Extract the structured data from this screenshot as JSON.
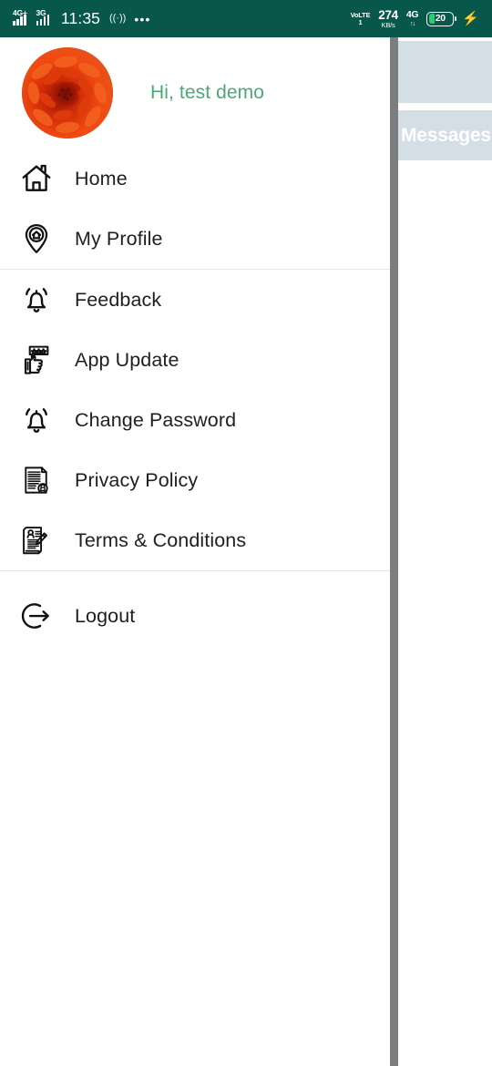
{
  "status_bar": {
    "background_color": "#07584A",
    "time": "11:35",
    "sim1_network": "4G+",
    "sim2_network": "3G",
    "hotspot_icon": "hotspot-icon",
    "overflow_icon": "more-dots-icon",
    "volte_label": "VoLTE1",
    "net_speed_value": "274",
    "net_speed_unit": "KB/s",
    "data_network": "4G",
    "data_arrows": "↑↓",
    "battery_percent": "20",
    "battery_fill_color": "#2ECC71",
    "charging_icon": "charging-bolt-icon",
    "charging_icon_color": "#F0D020"
  },
  "background_app": {
    "card_top_color": "#D3DEE5",
    "messages_label": "Messages",
    "messages_card_color": "#D3DEE5"
  },
  "drawer": {
    "edge_color": "#7B7D80",
    "profile": {
      "avatar_name": "user-avatar-flower",
      "greeting": "Hi, test demo",
      "greeting_color": "#4CA877"
    },
    "groups": [
      {
        "items": [
          {
            "id": "home",
            "label": "Home",
            "icon": "house-icon"
          },
          {
            "id": "my-profile",
            "label": "My Profile",
            "icon": "map-pin-house-icon"
          }
        ]
      },
      {
        "items": [
          {
            "id": "feedback",
            "label": "Feedback",
            "icon": "bell-ringing-icon"
          },
          {
            "id": "app-update",
            "label": "App Update",
            "icon": "thumbs-up-rating-icon"
          },
          {
            "id": "change-password",
            "label": "Change Password",
            "icon": "bell-ringing-icon"
          },
          {
            "id": "privacy-policy",
            "label": "Privacy Policy",
            "icon": "document-lock-icon"
          },
          {
            "id": "terms-conditions",
            "label": "Terms & Conditions",
            "icon": "contract-pen-icon"
          }
        ]
      },
      {
        "items": [
          {
            "id": "logout",
            "label": "Logout",
            "icon": "logout-arrow-icon"
          }
        ]
      }
    ]
  }
}
